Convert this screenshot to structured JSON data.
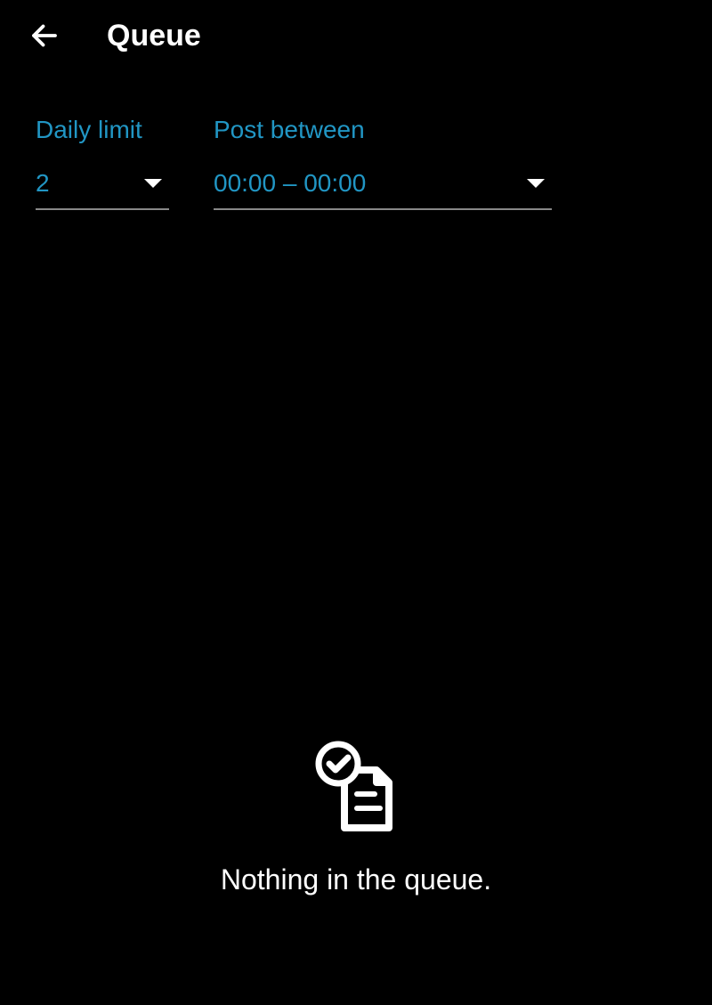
{
  "header": {
    "title": "Queue"
  },
  "controls": {
    "daily_limit": {
      "label": "Daily limit",
      "value": "2"
    },
    "post_between": {
      "label": "Post between",
      "value": "00:00 – 00:00"
    }
  },
  "empty_state": {
    "message": "Nothing in the queue."
  }
}
